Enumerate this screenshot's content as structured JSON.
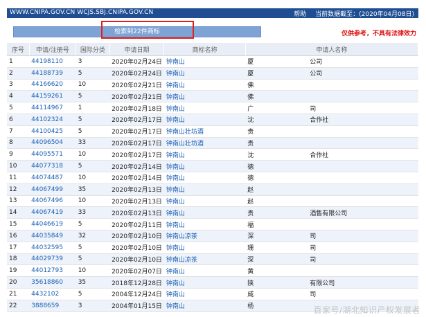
{
  "topbar": {
    "url": "WWW.CNIPA.GOV.CN  WCJS.SBJ.CNIPA.GOV.CN",
    "help": "帮助",
    "data_date": "当前数据截至：(2020年04月08日)"
  },
  "result_label": "检索到22件商标",
  "disclaimer": "仅供参考，不具有法律效力",
  "table": {
    "headers": [
      "序号",
      "申请/注册号",
      "国际分类",
      "申请日期",
      "商标名称",
      "申请人名称"
    ],
    "rows": [
      {
        "no": "1",
        "reg": "44198110",
        "cls": "3",
        "date": "2020年02月24日",
        "name": "钟南山",
        "a1": "厦",
        "a2": "公司"
      },
      {
        "no": "2",
        "reg": "44188739",
        "cls": "5",
        "date": "2020年02月24日",
        "name": "钟南山",
        "a1": "厦",
        "a2": "公司"
      },
      {
        "no": "3",
        "reg": "44166620",
        "cls": "10",
        "date": "2020年02月21日",
        "name": "钟南山",
        "a1": "佛",
        "a2": ""
      },
      {
        "no": "4",
        "reg": "44159261",
        "cls": "5",
        "date": "2020年02月21日",
        "name": "钟南山",
        "a1": "佛",
        "a2": ""
      },
      {
        "no": "5",
        "reg": "44114967",
        "cls": "1",
        "date": "2020年02月18日",
        "name": "钟南山",
        "a1": "广",
        "a2": "司"
      },
      {
        "no": "6",
        "reg": "44102324",
        "cls": "5",
        "date": "2020年02月17日",
        "name": "钟南山",
        "a1": "沈",
        "a2": "合作社"
      },
      {
        "no": "7",
        "reg": "44100425",
        "cls": "5",
        "date": "2020年02月17日",
        "name": "钟南山壮坊酒",
        "a1": "贵",
        "a2": ""
      },
      {
        "no": "8",
        "reg": "44096504",
        "cls": "33",
        "date": "2020年02月17日",
        "name": "钟南山壮坊酒",
        "a1": "贵",
        "a2": ""
      },
      {
        "no": "9",
        "reg": "44095571",
        "cls": "10",
        "date": "2020年02月17日",
        "name": "钟南山",
        "a1": "沈",
        "a2": "合作社"
      },
      {
        "no": "10",
        "reg": "44077318",
        "cls": "5",
        "date": "2020年02月14日",
        "name": "钟南山",
        "a1": "德",
        "a2": ""
      },
      {
        "no": "11",
        "reg": "44074487",
        "cls": "10",
        "date": "2020年02月14日",
        "name": "钟南山",
        "a1": "德",
        "a2": ""
      },
      {
        "no": "12",
        "reg": "44067499",
        "cls": "35",
        "date": "2020年02月13日",
        "name": "钟南山",
        "a1": "赵",
        "a2": ""
      },
      {
        "no": "13",
        "reg": "44067496",
        "cls": "10",
        "date": "2020年02月13日",
        "name": "钟南山",
        "a1": "赵",
        "a2": ""
      },
      {
        "no": "14",
        "reg": "44067419",
        "cls": "33",
        "date": "2020年02月13日",
        "name": "钟南山",
        "a1": "贵",
        "a2": "酒售有限公司"
      },
      {
        "no": "15",
        "reg": "44046619",
        "cls": "5",
        "date": "2020年02月11日",
        "name": "钟南山",
        "a1": "福",
        "a2": ""
      },
      {
        "no": "16",
        "reg": "44035849",
        "cls": "32",
        "date": "2020年02月10日",
        "name": "钟南山凉茶",
        "a1": "深",
        "a2": "司"
      },
      {
        "no": "17",
        "reg": "44032595",
        "cls": "5",
        "date": "2020年02月10日",
        "name": "钟南山",
        "a1": "珊",
        "a2": "司"
      },
      {
        "no": "18",
        "reg": "44029739",
        "cls": "5",
        "date": "2020年02月10日",
        "name": "钟南山凉茶",
        "a1": "深",
        "a2": "司"
      },
      {
        "no": "19",
        "reg": "44012793",
        "cls": "10",
        "date": "2020年02月07日",
        "name": "钟南山",
        "a1": "黄",
        "a2": ""
      },
      {
        "no": "20",
        "reg": "35618860",
        "cls": "35",
        "date": "2018年12月28日",
        "name": "钟南山",
        "a1": "陕",
        "a2": "有限公司"
      },
      {
        "no": "21",
        "reg": "4432102",
        "cls": "5",
        "date": "2004年12月24日",
        "name": "钟南山",
        "a1": "威",
        "a2": "司"
      },
      {
        "no": "22",
        "reg": "3888659",
        "cls": "3",
        "date": "2004年01月15日",
        "name": "钟南山",
        "a1": "杨",
        "a2": ""
      }
    ]
  },
  "watermark": "百家号/湖北知识产权发展者"
}
